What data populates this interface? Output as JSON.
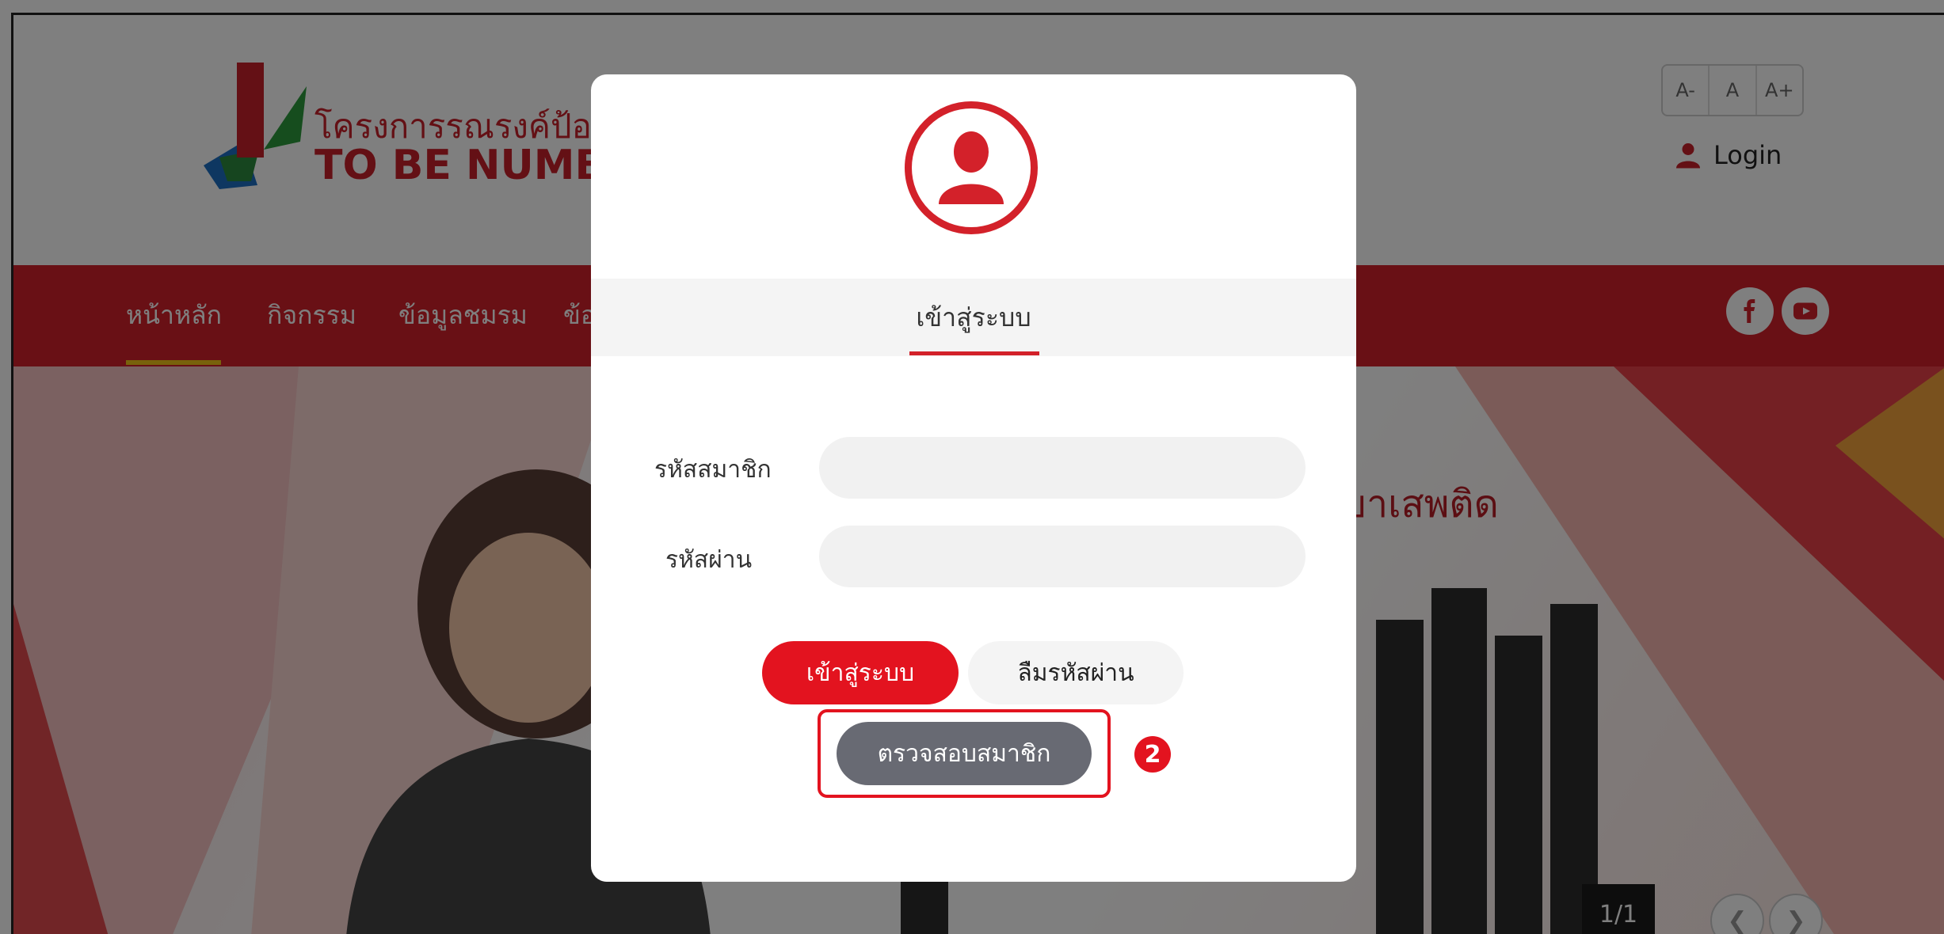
{
  "header": {
    "brand_th": "โครงการรณรงค์ป้อ",
    "brand_en": "TO BE NUMBER",
    "font_size_controls": [
      "A-",
      "A",
      "A+"
    ],
    "login_label": "Login"
  },
  "nav": {
    "items": [
      "หน้าหลัก",
      "กิจกรรม",
      "ข้อมูลชมรม",
      "ข้อ"
    ],
    "social": [
      {
        "name": "facebook"
      },
      {
        "name": "youtube"
      }
    ]
  },
  "banner": {
    "headline": "ยาเสพติด",
    "counter": "1/1",
    "prev": "❮",
    "next": "❯"
  },
  "modal": {
    "tab_label": "เข้าสู่ระบบ",
    "fields": {
      "member_id_label": "รหัสสมาชิก",
      "member_id_value": "",
      "password_label": "รหัสผ่าน",
      "password_value": ""
    },
    "login_button": "เข้าสู่ระบบ",
    "forgot_button": "ลืมรหัสผ่าน",
    "check_member_button": "ตรวจสอบสมาชิก",
    "step_badge": "2"
  },
  "colors": {
    "brand_red": "#d3212a",
    "button_red": "#e3131f",
    "button_gray": "#686a73",
    "nav_underline": "#f0c419"
  }
}
